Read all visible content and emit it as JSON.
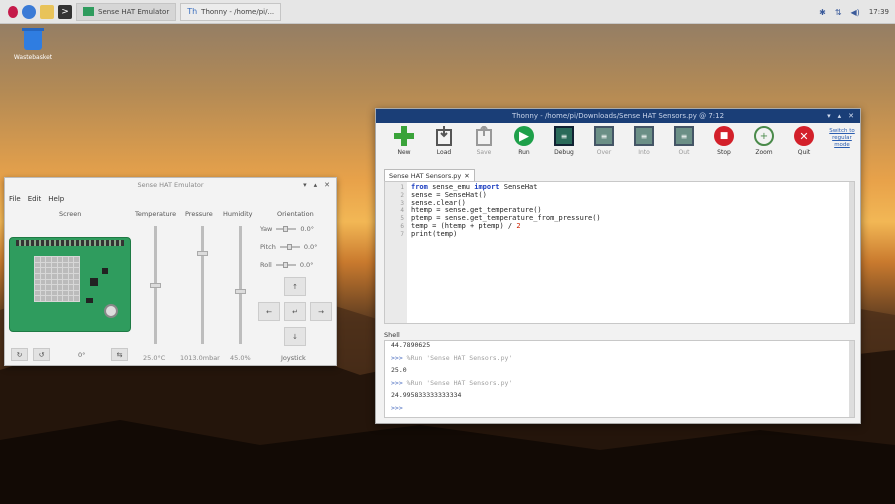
{
  "taskbar": {
    "windows": [
      {
        "label": "Sense HAT Emulator"
      },
      {
        "label": "Thonny - /home/pi/..."
      }
    ],
    "clock": "17:39"
  },
  "desktop": {
    "trash_label": "Wastebasket"
  },
  "emulator": {
    "title": "Sense HAT Emulator",
    "menu": [
      "File",
      "Edit",
      "Help"
    ],
    "headers": {
      "screen": "Screen",
      "temperature": "Temperature",
      "pressure": "Pressure",
      "humidity": "Humidity",
      "orientation": "Orientation"
    },
    "sliders": {
      "temperature": "25.0°C",
      "pressure": "1013.0mbar",
      "humidity": "45.0%"
    },
    "slider_levels": {
      "temperature": 0.5,
      "pressure": 0.77,
      "humidity": 0.45
    },
    "orientation": [
      {
        "label": "Yaw",
        "value": "0.0°"
      },
      {
        "label": "Pitch",
        "value": "0.0°"
      },
      {
        "label": "Roll",
        "value": "0.0°"
      }
    ],
    "rotation": "0°",
    "joystick_label": "Joystick"
  },
  "thonny": {
    "title": "Thonny - /home/pi/Downloads/Sense HAT Sensors.py @ 7:12",
    "tools": [
      {
        "label": "New",
        "icon": "plus-icon",
        "color": "#3aa33a"
      },
      {
        "label": "Load",
        "icon": "load-icon",
        "color": "#555555"
      },
      {
        "label": "Save",
        "icon": "save-icon",
        "color": "#999999"
      },
      {
        "label": "Run",
        "icon": "run-icon",
        "color": "#1ea04a"
      },
      {
        "label": "Debug",
        "icon": "debug-icon",
        "color": "#2a6a5a"
      },
      {
        "label": "Over",
        "icon": "step-over-icon",
        "color": "#6b8f86"
      },
      {
        "label": "Into",
        "icon": "step-into-icon",
        "color": "#6b8f86"
      },
      {
        "label": "Out",
        "icon": "step-out-icon",
        "color": "#6b8f86"
      },
      {
        "label": "Stop",
        "icon": "stop-icon",
        "color": "#d3202a"
      },
      {
        "label": "Zoom",
        "icon": "zoom-icon",
        "color": "#4a8a4a"
      },
      {
        "label": "Quit",
        "icon": "quit-icon",
        "color": "#d3202a"
      }
    ],
    "switch_mode": "Switch to regular mode",
    "tab": "Sense HAT Sensors.py",
    "code": [
      "from sense_emu import SenseHat",
      "sense = SenseHat()",
      "sense.clear()",
      "htemp = sense.get_temperature()",
      "ptemp = sense.get_temperature_from_pressure()",
      "temp = (htemp + ptemp) / 2",
      "print(temp)"
    ],
    "shell_label": "Shell",
    "shell": [
      {
        "kind": "out",
        "text": "44.7890625"
      },
      {
        "kind": "cmd",
        "prompt": ">>>",
        "text": "%Run 'Sense HAT Sensors.py'"
      },
      {
        "kind": "out",
        "text": "25.0"
      },
      {
        "kind": "cmd",
        "prompt": ">>>",
        "text": "%Run 'Sense HAT Sensors.py'"
      },
      {
        "kind": "out",
        "text": "24.995833333333334"
      },
      {
        "kind": "cmd",
        "prompt": ">>>",
        "text": ""
      }
    ]
  }
}
